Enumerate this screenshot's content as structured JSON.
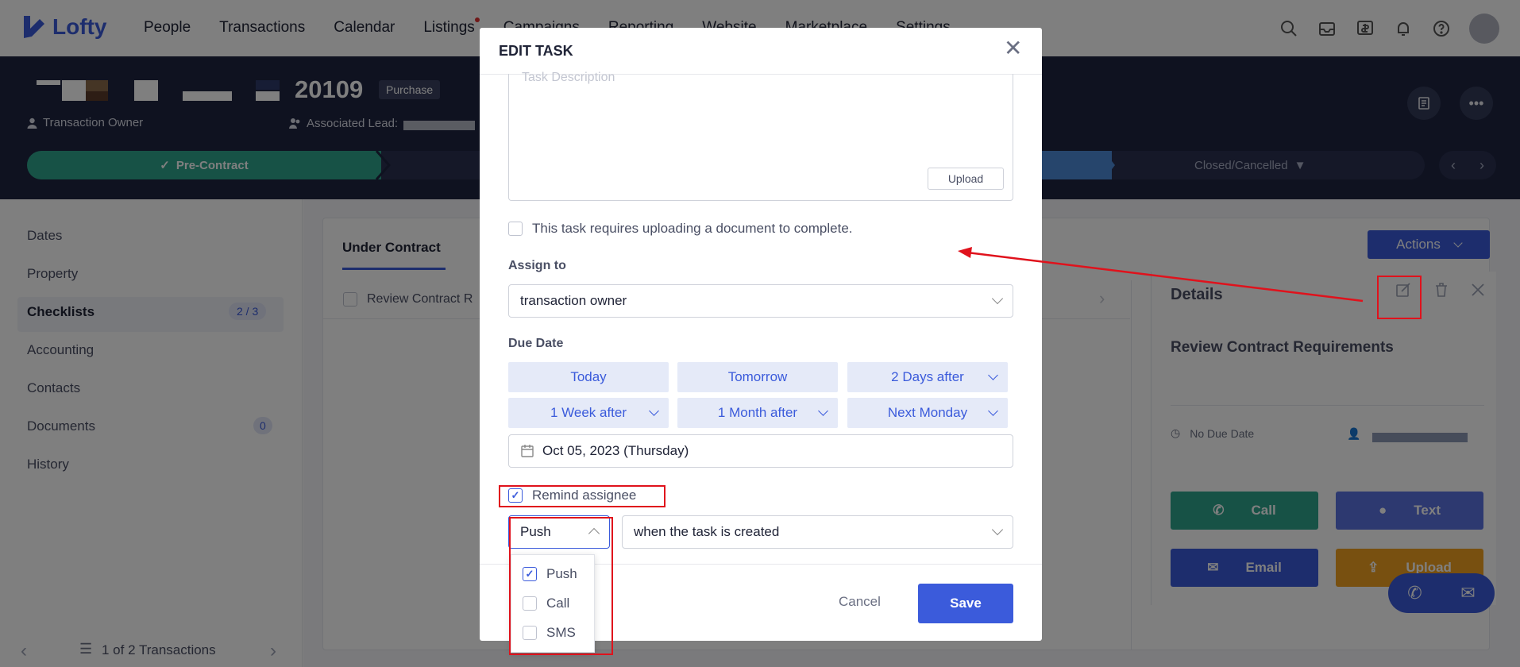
{
  "app": {
    "brand": "Lofty",
    "accent": "#3b5bdb"
  },
  "nav": {
    "items": [
      "People",
      "Transactions",
      "Calendar",
      "Listings",
      "Campaigns",
      "Reporting",
      "Website",
      "Marketplace",
      "Settings"
    ]
  },
  "header": {
    "address_number": "20109",
    "type_badge": "Purchase",
    "owner_label": "Transaction Owner",
    "lead_label": "Associated Lead:"
  },
  "pipeline": {
    "current_stage": "Pre-Contract",
    "closed_stage": "Closed/Cancelled"
  },
  "sidebar": {
    "items": [
      {
        "label": "Dates"
      },
      {
        "label": "Property"
      },
      {
        "label": "Checklists",
        "count": "2 / 3"
      },
      {
        "label": "Accounting"
      },
      {
        "label": "Contacts"
      },
      {
        "label": "Documents",
        "count": "0"
      },
      {
        "label": "History"
      }
    ],
    "footer": "1 of 2 Transactions"
  },
  "main": {
    "tab": "Under Contract",
    "actions_label": "Actions",
    "row_task": "Review Contract R"
  },
  "details": {
    "title": "Details",
    "task_name": "Review Contract Requirements",
    "due": "No Due Date",
    "buttons": {
      "call": "Call",
      "text": "Text",
      "email": "Email",
      "upload": "Upload"
    }
  },
  "modal": {
    "title": "EDIT TASK",
    "description_placeholder": "Task Description",
    "upload_label": "Upload",
    "require_doc_label": "This task requires uploading a document to complete.",
    "assign_label": "Assign to",
    "assign_value": "transaction owner",
    "due_label": "Due Date",
    "quick_dates": [
      "Today",
      "Tomorrow",
      "2 Days after",
      "1 Week after",
      "1 Month after",
      "Next Monday"
    ],
    "date_value": "Oct 05, 2023 (Thursday)",
    "remind_label": "Remind assignee",
    "remind_method": "Push",
    "remind_when": "when the task is created",
    "method_options": [
      {
        "label": "Push",
        "checked": true
      },
      {
        "label": "Call",
        "checked": false
      },
      {
        "label": "SMS",
        "checked": false
      }
    ],
    "cancel_label": "Cancel",
    "save_label": "Save"
  }
}
